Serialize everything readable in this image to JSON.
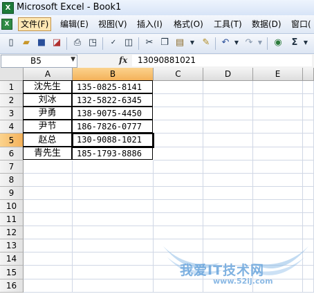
{
  "window": {
    "title": "Microsoft Excel - Book1",
    "app_icon": "excel-icon"
  },
  "menubar": {
    "doc_icon": "X",
    "items": [
      {
        "label": "文件(F)",
        "active": true
      },
      {
        "label": "编辑(E)"
      },
      {
        "label": "视图(V)"
      },
      {
        "label": "插入(I)"
      },
      {
        "label": "格式(O)"
      },
      {
        "label": "工具(T)"
      },
      {
        "label": "数据(D)"
      },
      {
        "label": "窗口("
      }
    ]
  },
  "toolbar": {
    "icons": [
      "new-icon",
      "open-icon",
      "save-icon",
      "permission-icon",
      "print-icon",
      "print-preview-icon",
      "spelling-icon",
      "research-icon",
      "cut-icon",
      "copy-icon",
      "paste-icon",
      "format-painter-icon",
      "undo-icon",
      "redo-icon",
      "hyperlink-icon",
      "autosum-icon"
    ]
  },
  "formula_bar": {
    "name_box": "B5",
    "fx": "fx",
    "formula": "13090881021"
  },
  "sheet": {
    "columns": [
      "A",
      "B",
      "C",
      "D",
      "E"
    ],
    "selected_column": "B",
    "rows": [
      "1",
      "2",
      "3",
      "4",
      "5",
      "6",
      "7",
      "8",
      "9",
      "10",
      "11",
      "12",
      "13",
      "14",
      "15",
      "16"
    ],
    "selected_row": "5",
    "data": [
      {
        "name": "沈先生",
        "phone": "135-0825-8141"
      },
      {
        "name": "刘冰",
        "phone": "132-5822-6345"
      },
      {
        "name": "尹勇",
        "phone": "138-9075-4450"
      },
      {
        "name": "尹节",
        "phone": "186-7826-0777"
      },
      {
        "name": "赵总",
        "phone": "130-9088-1021"
      },
      {
        "name": "青先生",
        "phone": "185-1793-8886"
      }
    ]
  },
  "watermark": {
    "text": "我爱IT技术网",
    "url": "www.52ij.com"
  },
  "colors": {
    "selection_header": "#f4b15a",
    "gridline": "#d0d7e5"
  }
}
